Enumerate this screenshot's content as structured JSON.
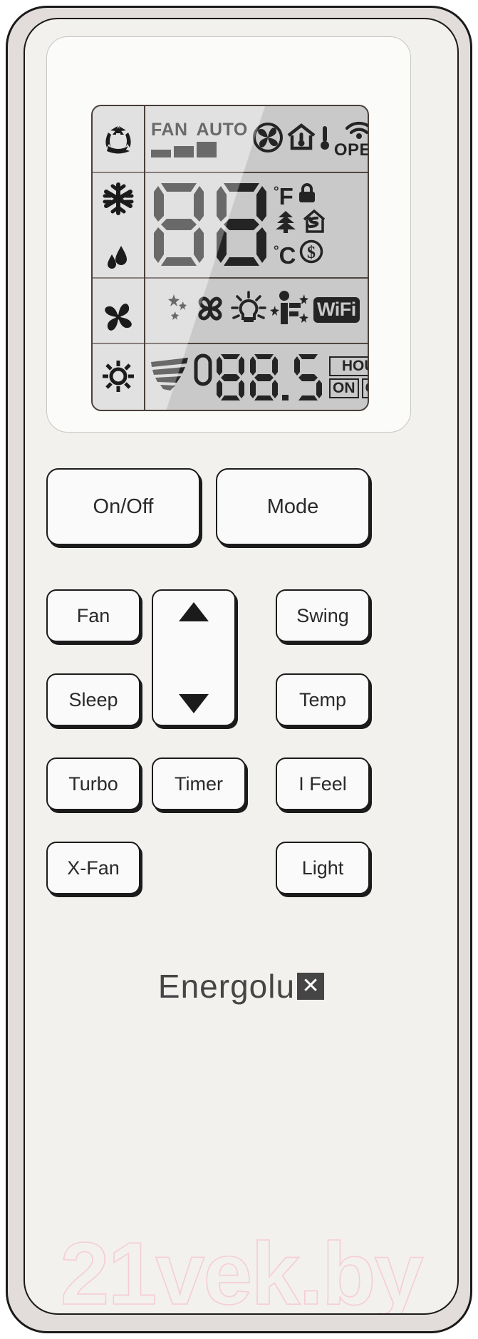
{
  "device": {
    "brand_text": "Energolu",
    "brand_mark": "✕",
    "brand_full": "Energolux"
  },
  "watermark": {
    "text": "21vek.by",
    "color": "#f6ccd8"
  },
  "lcd": {
    "background": "#d2d2d2",
    "frame_color": "#4a3f3a",
    "mode_icons": [
      {
        "name": "auto-mode-icon",
        "label": "Auto"
      },
      {
        "name": "cool-snowflake-icon",
        "label": "Cool"
      },
      {
        "name": "dry-droplets-icon",
        "label": "Dry"
      },
      {
        "name": "fan-pinwheel-icon",
        "label": "Fan"
      },
      {
        "name": "heat-sun-icon",
        "label": "Heat"
      }
    ],
    "top_row": {
      "fan_label": "FAN",
      "auto_label": "AUTO",
      "speed_bars": 3,
      "icons": [
        {
          "name": "fan-blade-icon",
          "label": "Fan running"
        },
        {
          "name": "house-thermometer-icon",
          "label": "Indoor temp"
        },
        {
          "name": "thermometer-icon",
          "label": "Outdoor temp"
        },
        {
          "name": "wifi-arc-icon",
          "label": "Wireless"
        }
      ],
      "oper_label": "OPER"
    },
    "temp_row": {
      "digits": "88",
      "fahrenheit": "F",
      "celsius": "C",
      "degree": "°",
      "icons": [
        {
          "name": "lock-icon",
          "label": "Child lock"
        },
        {
          "name": "tree-icon",
          "label": "Energy saving"
        },
        {
          "name": "house-airflow-icon",
          "label": "Air circulation"
        },
        {
          "name": "dollar-icon",
          "label": "Cost saving"
        }
      ]
    },
    "options_row": {
      "icons": [
        {
          "name": "moon-stars-icon",
          "label": "Sleep"
        },
        {
          "name": "clover-xfan-icon",
          "label": "X-Fan"
        },
        {
          "name": "light-bulb-icon",
          "label": "Light"
        },
        {
          "name": "i-feel-icon",
          "label": "I Feel"
        }
      ],
      "wifi_badge": "WiFi"
    },
    "timer_row": {
      "swing_icon": {
        "name": "swing-rays-icon",
        "label": "Swing"
      },
      "value": "088.5",
      "hour_label": "HOUR",
      "on_label": "ON",
      "off_label": "OFF"
    }
  },
  "buttons": {
    "onoff": "On/Off",
    "mode": "Mode",
    "fan": "Fan",
    "swing": "Swing",
    "sleep": "Sleep",
    "temp": "Temp",
    "turbo": "Turbo",
    "timer": "Timer",
    "ifeel": "I Feel",
    "xfan": "X-Fan",
    "light": "Light",
    "up": "▲",
    "down": "▼"
  }
}
